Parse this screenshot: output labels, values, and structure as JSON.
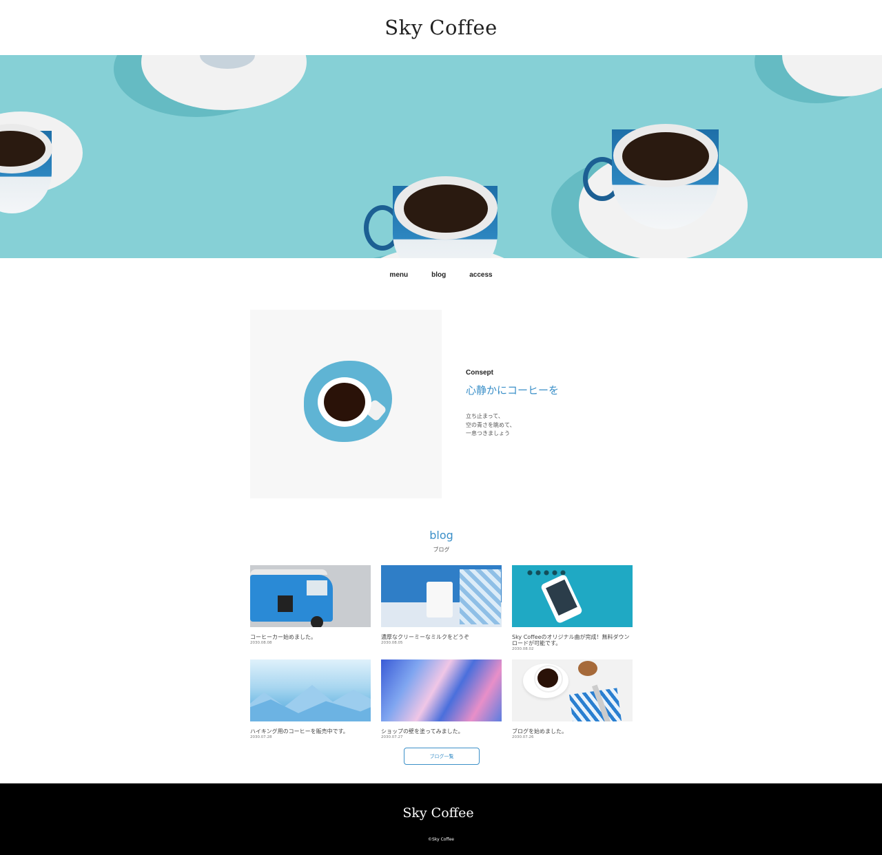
{
  "site": {
    "logo": "Sky Coffee"
  },
  "nav": {
    "items": [
      {
        "label": "menu"
      },
      {
        "label": "blog"
      },
      {
        "label": "access"
      }
    ]
  },
  "concept": {
    "label": "Consept",
    "title": "心静かにコーヒーを",
    "lines": [
      "立ち止まって、",
      "空の青さを眺めて、",
      "一息つきましょう"
    ]
  },
  "blog": {
    "heading": "blog",
    "subheading": "ブログ",
    "posts": [
      {
        "title": "コーヒーカー始めました。",
        "date": "2030.08.08"
      },
      {
        "title": "濃厚なクリーミーなミルクをどうぞ",
        "date": "2030.08.05"
      },
      {
        "title": "Sky Coffeeのオリジナル曲が完成！無料ダウンロードが可能です。",
        "date": "2030.08.02"
      },
      {
        "title": "ハイキング用のコーヒーを販売中です。",
        "date": "2030.07.28"
      },
      {
        "title": "ショップの壁を塗ってみました。",
        "date": "2030.07.27"
      },
      {
        "title": "ブログを始めました。",
        "date": "2030.07.26"
      }
    ],
    "more_button": "ブログ一覧"
  },
  "footer": {
    "logo": "Sky Coffee",
    "copyright": "©Sky Coffee"
  }
}
